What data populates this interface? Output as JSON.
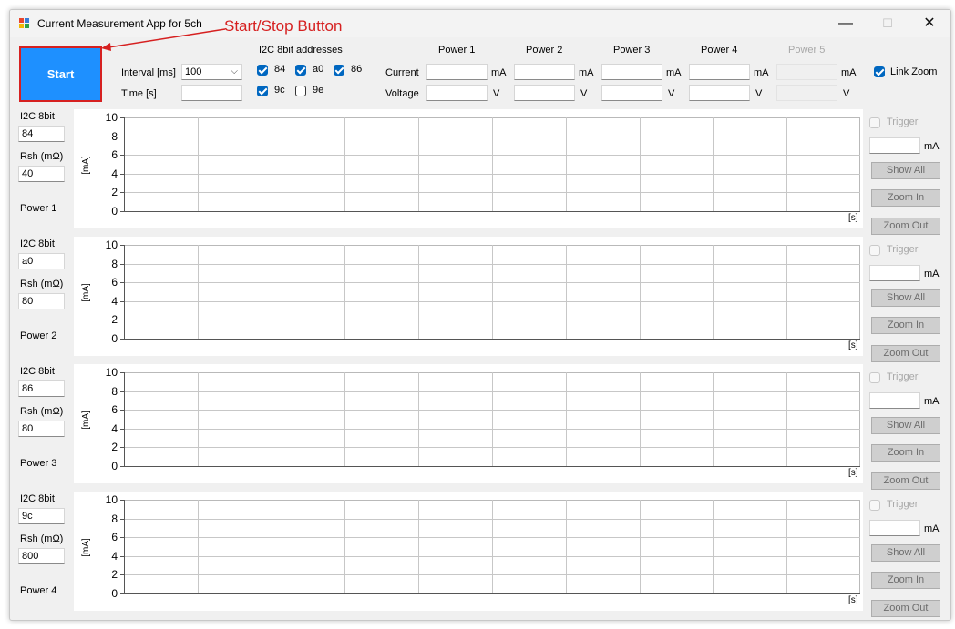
{
  "window": {
    "title": "Current Measurement App for 5ch",
    "minimize": "—",
    "maximize": "☐",
    "close": "✕"
  },
  "annotation": {
    "text": "Start/Stop Button",
    "color": "#d62020"
  },
  "start_button": {
    "label": "Start",
    "color": "#1e90ff"
  },
  "settings": {
    "interval_label": "Interval [ms]",
    "interval_value": "100",
    "time_label": "Time [s]",
    "time_value": ""
  },
  "i2c": {
    "heading": "I2C 8bit addresses",
    "addresses": [
      {
        "label": "84",
        "checked": true
      },
      {
        "label": "a0",
        "checked": true
      },
      {
        "label": "86",
        "checked": true
      },
      {
        "label": "9c",
        "checked": true
      },
      {
        "label": "9e",
        "checked": false
      }
    ]
  },
  "readout": {
    "current_label": "Current",
    "voltage_label": "Voltage",
    "current_unit": "mA",
    "voltage_unit": "V",
    "channels": [
      {
        "name": "Power 1",
        "current": "",
        "voltage": "",
        "enabled": true
      },
      {
        "name": "Power 2",
        "current": "",
        "voltage": "",
        "enabled": true
      },
      {
        "name": "Power 3",
        "current": "",
        "voltage": "",
        "enabled": true
      },
      {
        "name": "Power 4",
        "current": "",
        "voltage": "",
        "enabled": true
      },
      {
        "name": "Power 5",
        "current": "",
        "voltage": "",
        "enabled": false
      }
    ]
  },
  "link_zoom": {
    "label": "Link Zoom",
    "checked": true
  },
  "panels": [
    {
      "addr_label": "I2C 8bit",
      "addr_value": "84",
      "rsh_label": "Rsh (mΩ)",
      "rsh_value": "40",
      "power_label": "Power 1"
    },
    {
      "addr_label": "I2C 8bit",
      "addr_value": "a0",
      "rsh_label": "Rsh (mΩ)",
      "rsh_value": "80",
      "power_label": "Power 2"
    },
    {
      "addr_label": "I2C 8bit",
      "addr_value": "86",
      "rsh_label": "Rsh (mΩ)",
      "rsh_value": "80",
      "power_label": "Power 3"
    },
    {
      "addr_label": "I2C 8bit",
      "addr_value": "9c",
      "rsh_label": "Rsh (mΩ)",
      "rsh_value": "800",
      "power_label": "Power 4"
    }
  ],
  "chart": {
    "y_unit": "[mA]",
    "x_unit": "[s]",
    "y_ticks": [
      "10",
      "8",
      "6",
      "4",
      "2",
      "0"
    ],
    "ylim": [
      0,
      10
    ],
    "x_divisions": 10
  },
  "side_controls": {
    "trigger_label": "Trigger",
    "trigger_value": "",
    "trigger_unit": "mA",
    "show_all": "Show All",
    "zoom_in": "Zoom In",
    "zoom_out": "Zoom Out"
  }
}
